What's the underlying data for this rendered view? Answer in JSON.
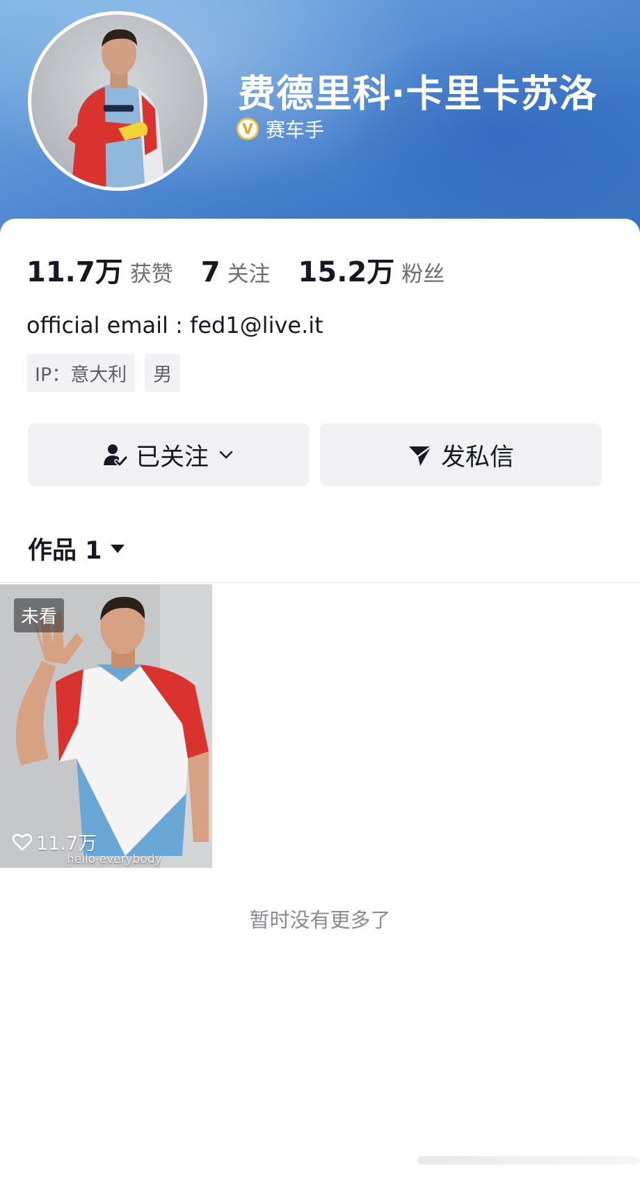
{
  "profile": {
    "name": "费德里科·卡里卡苏洛",
    "verified_title": "赛车手",
    "bio": "official email : fed1@live.it"
  },
  "stats": [
    {
      "value": "11.7万",
      "label": "获赞"
    },
    {
      "value": "7",
      "label": "关注"
    },
    {
      "value": "15.2万",
      "label": "粉丝"
    }
  ],
  "tags": [
    "IP：意大利",
    "男"
  ],
  "actions": {
    "follow_label": "已关注",
    "message_label": "发私信"
  },
  "works": {
    "label": "作品 1",
    "items": [
      {
        "badge": "未看",
        "likes": "11.7万",
        "caption": "hello everybody"
      }
    ],
    "no_more": "暂时没有更多了"
  },
  "colors": {
    "banner_start": "#7fb6e6",
    "banner_end": "#3a71bf",
    "verify_gold": "#f2c449",
    "button_bg": "#f1f1f3"
  },
  "icons": {
    "verify": "verified-badge-icon",
    "follow": "user-check-icon",
    "chevron": "chevron-down-icon",
    "message": "paper-plane-icon",
    "dropdown": "caret-down-icon",
    "like": "heart-icon"
  }
}
